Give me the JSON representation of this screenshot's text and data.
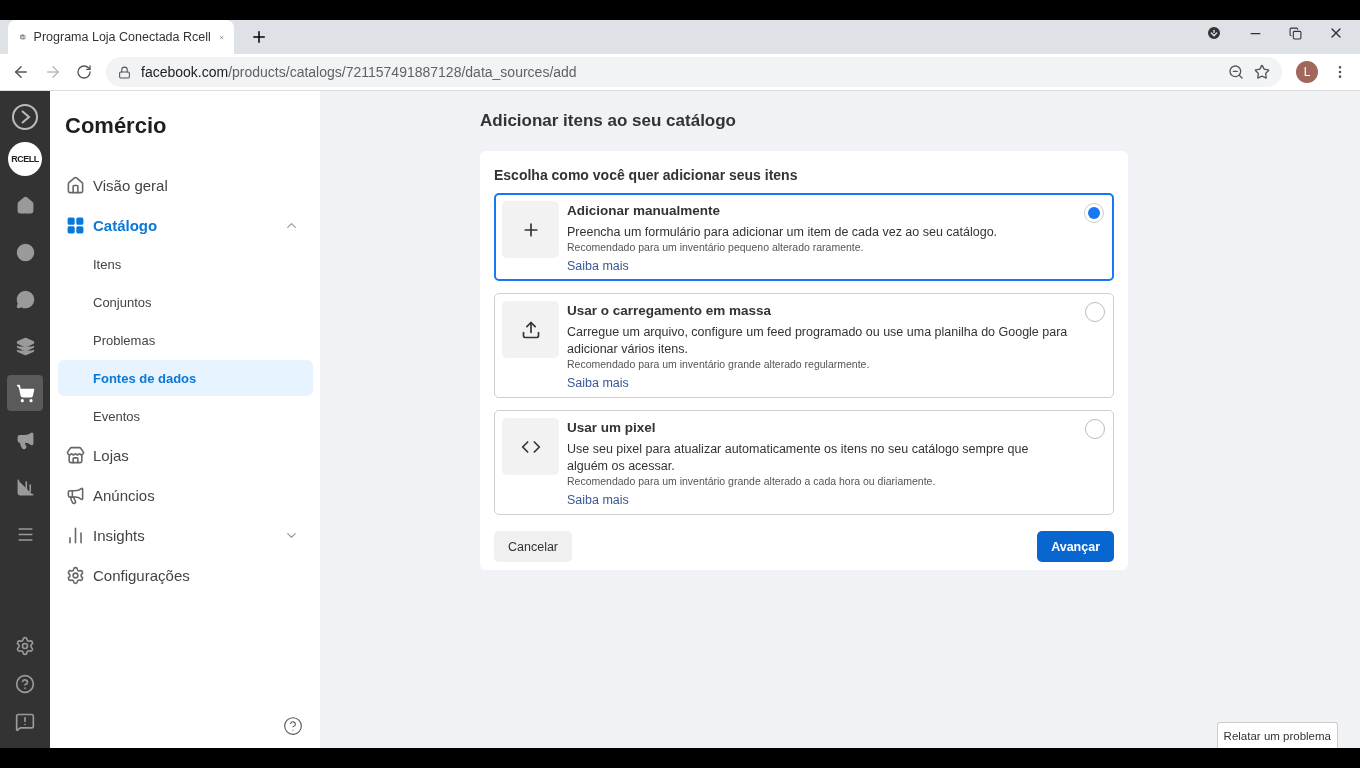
{
  "browser": {
    "tab_title": "Programa Loja Conectada Rcell",
    "url_host": "facebook.com",
    "url_path": "/products/catalogs/721157491887128/data_sources/add",
    "profile_initial": "L"
  },
  "rail": {
    "logo_text": "RCELL",
    "items": [
      {
        "selected": false
      },
      {
        "selected": false
      },
      {
        "selected": false
      },
      {
        "selected": false
      },
      {
        "selected": true
      },
      {
        "selected": false
      },
      {
        "selected": false
      },
      {
        "selected": false
      }
    ]
  },
  "sidebar": {
    "title": "Comércio",
    "items": [
      {
        "label": "Visão geral",
        "selected": false
      },
      {
        "label": "Catálogo",
        "selected": true,
        "expanded": true,
        "children": [
          {
            "label": "Itens",
            "selected": false
          },
          {
            "label": "Conjuntos",
            "selected": false
          },
          {
            "label": "Problemas",
            "selected": false
          },
          {
            "label": "Fontes de dados",
            "selected": true
          },
          {
            "label": "Eventos",
            "selected": false
          }
        ]
      },
      {
        "label": "Lojas",
        "selected": false
      },
      {
        "label": "Anúncios",
        "selected": false
      },
      {
        "label": "Insights",
        "selected": false,
        "expanded": false
      },
      {
        "label": "Configurações",
        "selected": false
      }
    ]
  },
  "main": {
    "heading": "Adicionar itens ao seu catálogo",
    "prompt": "Escolha como você quer adicionar seus itens",
    "options": [
      {
        "title": "Adicionar manualmente",
        "description": "Preencha um formulário para adicionar um item de cada vez ao seu catálogo.",
        "note": "Recomendado para um inventário pequeno alterado raramente.",
        "link": "Saiba mais",
        "selected": true
      },
      {
        "title": "Usar o carregamento em massa",
        "description": "Carregue um arquivo, configure um feed programado ou use uma planilha do Google para adicionar vários itens.",
        "note": "Recomendado para um inventário grande alterado regularmente.",
        "link": "Saiba mais",
        "selected": false
      },
      {
        "title": "Usar um pixel",
        "description": "Use seu pixel para atualizar automaticamente os itens no seu catálogo sempre que alguém os acessar.",
        "note": "Recomendado para um inventário grande alterado a cada hora ou diariamente.",
        "link": "Saiba mais",
        "selected": false
      }
    ],
    "cancel": "Cancelar",
    "next": "Avançar"
  },
  "report_button": "Relatar um problema"
}
